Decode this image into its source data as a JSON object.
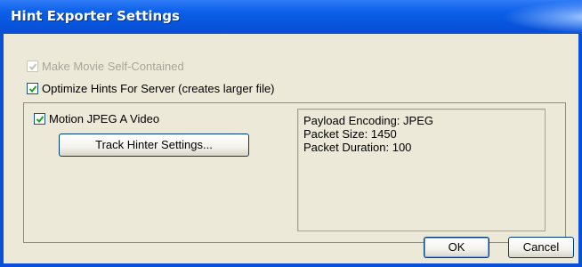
{
  "window": {
    "title": "Hint Exporter Settings"
  },
  "options": {
    "self_contained": {
      "label": "Make Movie Self-Contained",
      "checked": true,
      "disabled": true
    },
    "optimize_hints": {
      "label": "Optimize Hints For Server (creates larger file)",
      "checked": true,
      "disabled": false
    }
  },
  "track": {
    "label": "Motion JPEG A Video",
    "checked": true,
    "settings_button": "Track Hinter Settings..."
  },
  "info": {
    "lines": [
      "Payload Encoding: JPEG",
      "Packet Size: 1450",
      "Packet Duration: 100"
    ]
  },
  "buttons": {
    "ok": "OK",
    "cancel": "Cancel"
  },
  "colors": {
    "titlebar": "#0a4fd8",
    "dialog_bg": "#ece9d8",
    "checkmark": "#21a121"
  }
}
